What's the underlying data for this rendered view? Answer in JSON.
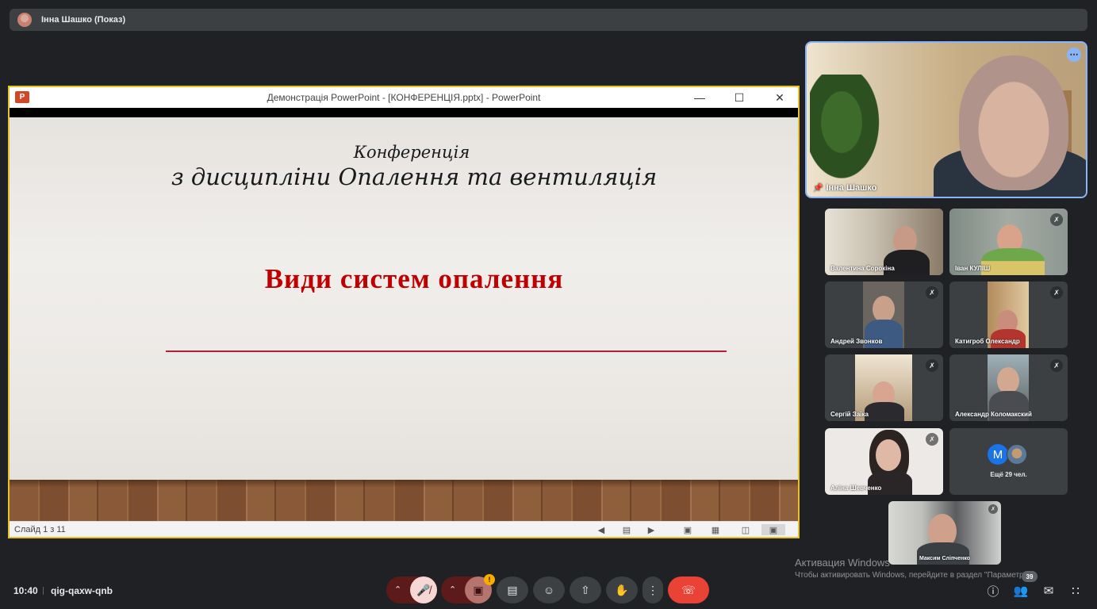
{
  "presenter_bar": {
    "label": "Інна Шашко (Показ)"
  },
  "presentation": {
    "window_title": "Демонстрація PowerPoint - [КОНФЕРЕНЦІЯ.pptx] - PowerPoint",
    "app_icon_letter": "P",
    "slide": {
      "line1": "Конференція",
      "line2": "з дисципліни Опалення та вентиляція",
      "heading": "Види систем опалення",
      "heading_color": "#c00000"
    },
    "status": {
      "slide_counter": "Слайд 1 з 11"
    }
  },
  "speaker": {
    "name": "Інна Шашко"
  },
  "participants": [
    {
      "name": "Валентина Сорокіна",
      "muted": false
    },
    {
      "name": "Іван КУЛІШ",
      "muted": true
    },
    {
      "name": "Андрей Звонков",
      "muted": true
    },
    {
      "name": "Катигроб Олександр",
      "muted": true
    },
    {
      "name": "Сергій Заїка",
      "muted": true
    },
    {
      "name": "Александр Коломакский",
      "muted": true
    },
    {
      "name": "Аліна Шевченко",
      "muted": true
    }
  ],
  "more_tile": {
    "avatar_letter": "M",
    "label": "Ещё 29 чел."
  },
  "self_view": {
    "name": "Максим Сліпченко"
  },
  "watermark": {
    "title": "Активация Windows",
    "text": "Чтобы активировать Windows, перейдите в раздел \"Параметры\"."
  },
  "bottom_bar": {
    "time": "10:40",
    "meeting_code": "qig-qaxw-qnb",
    "people_count": "39",
    "warning_badge": "!"
  },
  "colors": {
    "background": "#202124",
    "accent": "#8ab4f8",
    "end_call": "#ea4335",
    "pp_border": "#e6c229"
  }
}
